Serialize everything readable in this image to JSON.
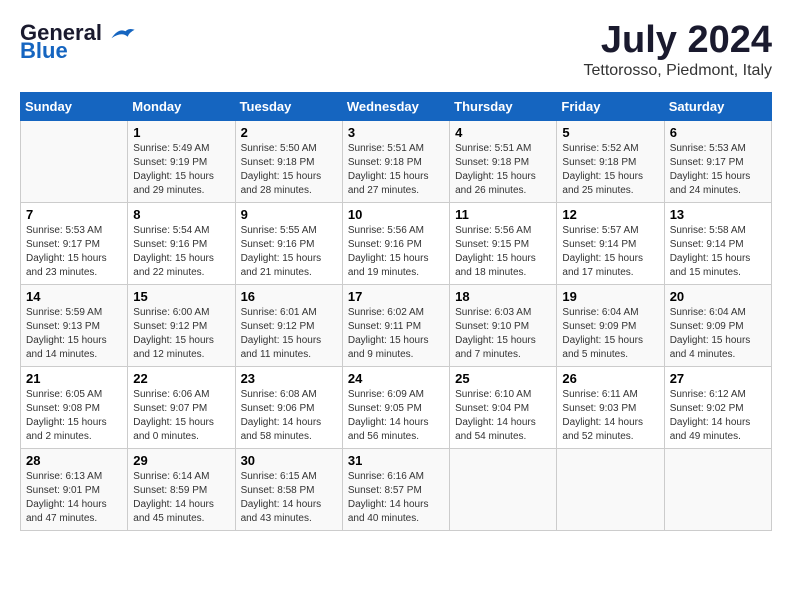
{
  "logo": {
    "part1": "General",
    "part2": "Blue"
  },
  "title": "July 2024",
  "location": "Tettorosso, Piedmont, Italy",
  "days_of_week": [
    "Sunday",
    "Monday",
    "Tuesday",
    "Wednesday",
    "Thursday",
    "Friday",
    "Saturday"
  ],
  "weeks": [
    [
      {
        "day": "",
        "info": ""
      },
      {
        "day": "1",
        "info": "Sunrise: 5:49 AM\nSunset: 9:19 PM\nDaylight: 15 hours\nand 29 minutes."
      },
      {
        "day": "2",
        "info": "Sunrise: 5:50 AM\nSunset: 9:18 PM\nDaylight: 15 hours\nand 28 minutes."
      },
      {
        "day": "3",
        "info": "Sunrise: 5:51 AM\nSunset: 9:18 PM\nDaylight: 15 hours\nand 27 minutes."
      },
      {
        "day": "4",
        "info": "Sunrise: 5:51 AM\nSunset: 9:18 PM\nDaylight: 15 hours\nand 26 minutes."
      },
      {
        "day": "5",
        "info": "Sunrise: 5:52 AM\nSunset: 9:18 PM\nDaylight: 15 hours\nand 25 minutes."
      },
      {
        "day": "6",
        "info": "Sunrise: 5:53 AM\nSunset: 9:17 PM\nDaylight: 15 hours\nand 24 minutes."
      }
    ],
    [
      {
        "day": "7",
        "info": "Sunrise: 5:53 AM\nSunset: 9:17 PM\nDaylight: 15 hours\nand 23 minutes."
      },
      {
        "day": "8",
        "info": "Sunrise: 5:54 AM\nSunset: 9:16 PM\nDaylight: 15 hours\nand 22 minutes."
      },
      {
        "day": "9",
        "info": "Sunrise: 5:55 AM\nSunset: 9:16 PM\nDaylight: 15 hours\nand 21 minutes."
      },
      {
        "day": "10",
        "info": "Sunrise: 5:56 AM\nSunset: 9:16 PM\nDaylight: 15 hours\nand 19 minutes."
      },
      {
        "day": "11",
        "info": "Sunrise: 5:56 AM\nSunset: 9:15 PM\nDaylight: 15 hours\nand 18 minutes."
      },
      {
        "day": "12",
        "info": "Sunrise: 5:57 AM\nSunset: 9:14 PM\nDaylight: 15 hours\nand 17 minutes."
      },
      {
        "day": "13",
        "info": "Sunrise: 5:58 AM\nSunset: 9:14 PM\nDaylight: 15 hours\nand 15 minutes."
      }
    ],
    [
      {
        "day": "14",
        "info": "Sunrise: 5:59 AM\nSunset: 9:13 PM\nDaylight: 15 hours\nand 14 minutes."
      },
      {
        "day": "15",
        "info": "Sunrise: 6:00 AM\nSunset: 9:12 PM\nDaylight: 15 hours\nand 12 minutes."
      },
      {
        "day": "16",
        "info": "Sunrise: 6:01 AM\nSunset: 9:12 PM\nDaylight: 15 hours\nand 11 minutes."
      },
      {
        "day": "17",
        "info": "Sunrise: 6:02 AM\nSunset: 9:11 PM\nDaylight: 15 hours\nand 9 minutes."
      },
      {
        "day": "18",
        "info": "Sunrise: 6:03 AM\nSunset: 9:10 PM\nDaylight: 15 hours\nand 7 minutes."
      },
      {
        "day": "19",
        "info": "Sunrise: 6:04 AM\nSunset: 9:09 PM\nDaylight: 15 hours\nand 5 minutes."
      },
      {
        "day": "20",
        "info": "Sunrise: 6:04 AM\nSunset: 9:09 PM\nDaylight: 15 hours\nand 4 minutes."
      }
    ],
    [
      {
        "day": "21",
        "info": "Sunrise: 6:05 AM\nSunset: 9:08 PM\nDaylight: 15 hours\nand 2 minutes."
      },
      {
        "day": "22",
        "info": "Sunrise: 6:06 AM\nSunset: 9:07 PM\nDaylight: 15 hours\nand 0 minutes."
      },
      {
        "day": "23",
        "info": "Sunrise: 6:08 AM\nSunset: 9:06 PM\nDaylight: 14 hours\nand 58 minutes."
      },
      {
        "day": "24",
        "info": "Sunrise: 6:09 AM\nSunset: 9:05 PM\nDaylight: 14 hours\nand 56 minutes."
      },
      {
        "day": "25",
        "info": "Sunrise: 6:10 AM\nSunset: 9:04 PM\nDaylight: 14 hours\nand 54 minutes."
      },
      {
        "day": "26",
        "info": "Sunrise: 6:11 AM\nSunset: 9:03 PM\nDaylight: 14 hours\nand 52 minutes."
      },
      {
        "day": "27",
        "info": "Sunrise: 6:12 AM\nSunset: 9:02 PM\nDaylight: 14 hours\nand 49 minutes."
      }
    ],
    [
      {
        "day": "28",
        "info": "Sunrise: 6:13 AM\nSunset: 9:01 PM\nDaylight: 14 hours\nand 47 minutes."
      },
      {
        "day": "29",
        "info": "Sunrise: 6:14 AM\nSunset: 8:59 PM\nDaylight: 14 hours\nand 45 minutes."
      },
      {
        "day": "30",
        "info": "Sunrise: 6:15 AM\nSunset: 8:58 PM\nDaylight: 14 hours\nand 43 minutes."
      },
      {
        "day": "31",
        "info": "Sunrise: 6:16 AM\nSunset: 8:57 PM\nDaylight: 14 hours\nand 40 minutes."
      },
      {
        "day": "",
        "info": ""
      },
      {
        "day": "",
        "info": ""
      },
      {
        "day": "",
        "info": ""
      }
    ]
  ]
}
